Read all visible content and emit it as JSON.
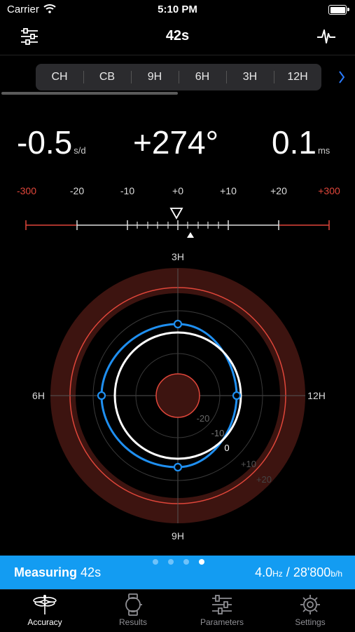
{
  "status": {
    "carrier": "Carrier",
    "time": "5:10 PM"
  },
  "nav": {
    "title": "42s"
  },
  "segments": [
    "CH",
    "CB",
    "9H",
    "6H",
    "3H",
    "12H"
  ],
  "readings": {
    "rate": "-0.5",
    "rate_unit": "s/d",
    "amplitude": "+274°",
    "beat_error": "0.1",
    "beat_error_unit": "ms"
  },
  "scale_labels": {
    "l300": "-300",
    "l20": "-20",
    "l10": "-10",
    "zero": "+0",
    "p10": "+10",
    "p20": "+20",
    "p300": "+300"
  },
  "polar": {
    "top": "3H",
    "left": "6H",
    "right": "12H",
    "bottom": "9H",
    "r_m20": "-20",
    "r_m10": "-10",
    "r_0": "0",
    "r_p10": "+10",
    "r_p20": "+20"
  },
  "measure": {
    "label": "Measuring",
    "time": "42s",
    "freq": "4.0",
    "freq_unit": "Hz",
    "sep": "/",
    "bph": "28'800",
    "bph_unit": "b/h"
  },
  "pager": {
    "count": 4,
    "active": 4
  },
  "tabs": {
    "accuracy": "Accuracy",
    "results": "Results",
    "parameters": "Parameters",
    "settings": "Settings"
  },
  "colors": {
    "accent": "#139cf2",
    "red": "#e0463a",
    "curve": "#1f8ff0"
  }
}
